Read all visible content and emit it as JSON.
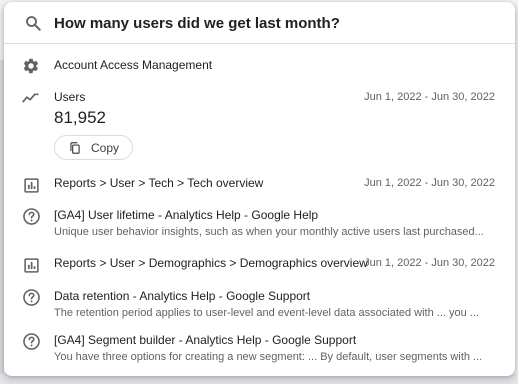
{
  "search": {
    "query": "How many users did we get last month?"
  },
  "results": [
    {
      "title": "Account Access Management",
      "icon": "gear-icon"
    },
    {
      "title": "Users",
      "date": "Jun 1, 2022 - Jun 30, 2022",
      "value": "81,952",
      "action": "Copy",
      "icon": "trending-icon"
    },
    {
      "title": "Reports > User > Tech > Tech overview",
      "date": "Jun 1, 2022 - Jun 30, 2022",
      "icon": "report-icon"
    },
    {
      "title": "[GA4] User lifetime - Analytics Help - Google Help",
      "desc": "Unique user behavior insights, such as when your monthly active users last purchased...",
      "icon": "help-icon"
    },
    {
      "title": "Reports > User > Demographics > Demographics overview",
      "date": "Jun 1, 2022 - Jun 30, 2022",
      "icon": "report-icon"
    },
    {
      "title": "Data retention - Analytics Help - Google Support",
      "desc": "The retention period applies to user-level and event-level data associated with ... you ...",
      "icon": "help-icon"
    },
    {
      "title": "[GA4] Segment builder - Analytics Help - Google Support",
      "desc": "You have three options for creating a new segment: ... By default, user segments with ...",
      "icon": "help-icon"
    }
  ],
  "colors": {
    "text_primary": "#202124",
    "text_secondary": "#5f6368",
    "icon": "#5f6368",
    "divider": "#e0e0e0"
  }
}
